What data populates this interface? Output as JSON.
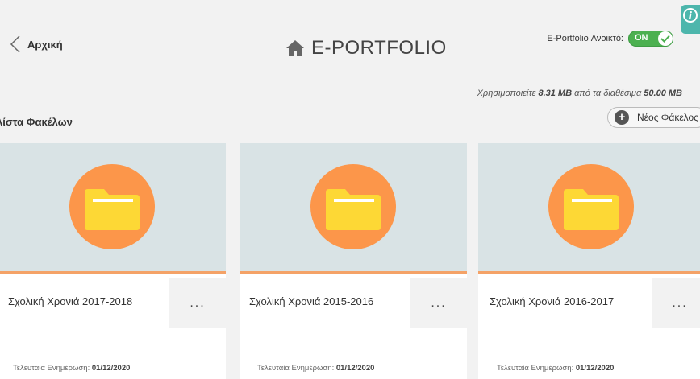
{
  "header": {
    "back_label": "Αρχική",
    "title": "E-PORTFOLIO",
    "toggle_label": "E-Portfolio Ανοικτό:",
    "toggle_state": "ON"
  },
  "usage": {
    "prefix": "Χρησιμοποιείτε",
    "used": "8.31 MB",
    "middle": "από τα διαθέσιμα",
    "total": "50.00 MB"
  },
  "section_title": "λίστα Φακέλων",
  "new_folder_label": "Νέος Φάκελος",
  "folders": [
    {
      "name": "Σχολική Χρονιά 2017-2018",
      "updated_label": "Τελευταία Ενημέρωση:",
      "updated": "01/12/2020",
      "menu": "..."
    },
    {
      "name": "Σχολική Χρονιά 2015-2016",
      "updated_label": "Τελευταία Ενημέρωση:",
      "updated": "01/12/2020",
      "menu": "..."
    },
    {
      "name": "Σχολική Χρονιά 2016-2017",
      "updated_label": "Τελευταία Ενημέρωση:",
      "updated": "01/12/2020",
      "menu": "..."
    }
  ],
  "colors": {
    "accent_orange": "#fc964a",
    "folder_yellow": "#fdd835",
    "toggle_green": "#4cb050",
    "banner_bg": "#d9e3e5",
    "info_teal": "#4db6ac"
  },
  "icons": [
    "chevron-left-icon",
    "home-icon",
    "check-icon",
    "info-icon",
    "plus-icon",
    "folder-icon",
    "more-icon"
  ]
}
